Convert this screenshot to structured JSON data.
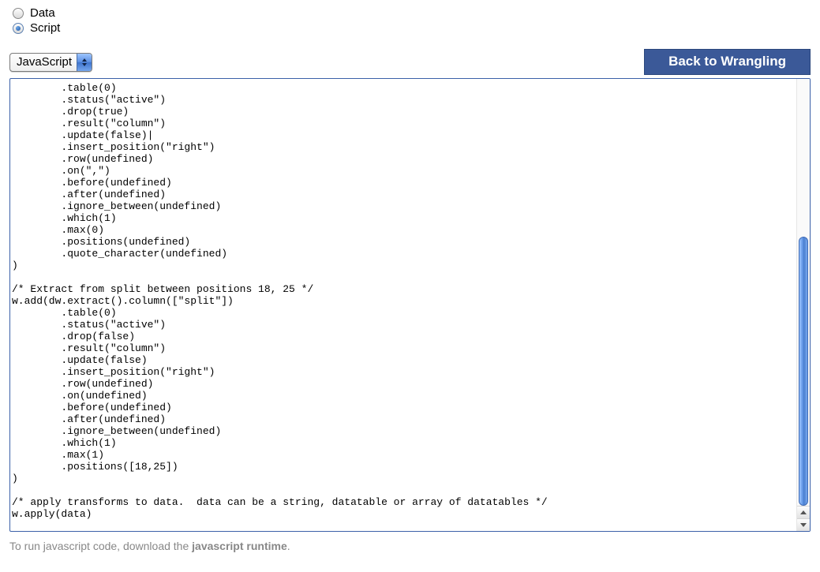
{
  "radios": {
    "data_label": "Data",
    "script_label": "Script",
    "selected": "script"
  },
  "language_select": {
    "value": "JavaScript"
  },
  "back_button": {
    "label": "Back to Wrangling"
  },
  "code": "        .table(0)\n        .status(\"active\")\n        .drop(true)\n        .result(\"column\")\n        .update(false)|\n        .insert_position(\"right\")\n        .row(undefined)\n        .on(\",\")\n        .before(undefined)\n        .after(undefined)\n        .ignore_between(undefined)\n        .which(1)\n        .max(0)\n        .positions(undefined)\n        .quote_character(undefined)\n)\n\n/* Extract from split between positions 18, 25 */\nw.add(dw.extract().column([\"split\"])\n        .table(0)\n        .status(\"active\")\n        .drop(false)\n        .result(\"column\")\n        .update(false)\n        .insert_position(\"right\")\n        .row(undefined)\n        .on(undefined)\n        .before(undefined)\n        .after(undefined)\n        .ignore_between(undefined)\n        .which(1)\n        .max(1)\n        .positions([18,25])\n)\n\n/* apply transforms to data.  data can be a string, datatable or array of datatables */\nw.apply(data)\n",
  "footer": {
    "prefix": "To run javascript code, download the ",
    "link": "javascript runtime",
    "suffix": "."
  }
}
